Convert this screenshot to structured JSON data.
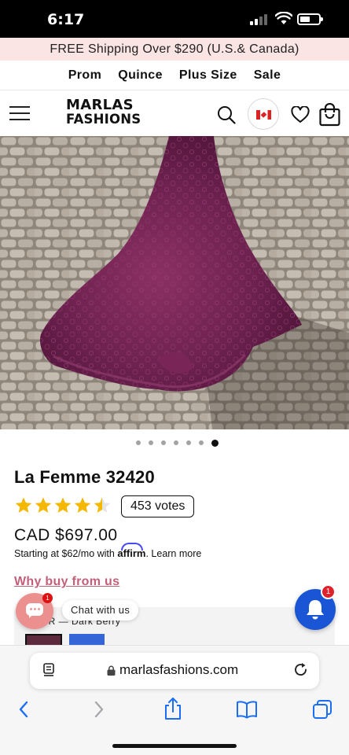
{
  "status_bar": {
    "time": "6:17"
  },
  "promo": {
    "text": "FREE Shipping Over $290 (U.S.& Canada)"
  },
  "top_nav": {
    "items": [
      "Prom",
      "Quince",
      "Plus Size",
      "Sale"
    ]
  },
  "header": {
    "logo_line1": "MARLAS",
    "logo_line2": "FASHIONS"
  },
  "gallery": {
    "total_images": 7,
    "active_index": 6
  },
  "product": {
    "title": "La Femme 32420",
    "rating": 4.5,
    "votes_label": "453 votes",
    "price": "CAD $697.00",
    "affirm_prefix": "Starting at $62/mo with",
    "affirm_brand": "affirm",
    "affirm_suffix": ". Learn more",
    "why_buy": "Why buy from us",
    "color_label": "O R  — Dark Berry"
  },
  "chat": {
    "label": "Chat with us",
    "badge": "1"
  },
  "notifications": {
    "badge": "1"
  },
  "browser": {
    "url": "marlasfashions.com"
  },
  "colors": {
    "promo_bg": "#fbe4e4",
    "accent_pink": "#c2607a",
    "star": "#f5b800",
    "chat_bubble": "#eb8f8f",
    "bell": "#1a55d6",
    "ios_blue": "#1a6ef5",
    "dress": "#6a1f48"
  }
}
